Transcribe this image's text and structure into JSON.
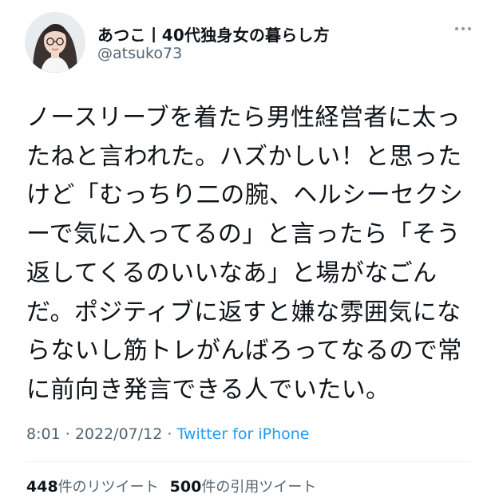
{
  "author": {
    "display_name": "あつこ丨40代独身女の暮らし方",
    "handle": "@atsuko73",
    "avatar_icon": "profile-photo-avatar"
  },
  "tweet": {
    "lines": [
      "ノースリーブを着たら男性経営者に太っ",
      "たねと言われた。ハズかしい！と思った",
      "けど「むっちり二の腕、ヘルシーセクシ",
      "ーで気に入ってるの」と言ったら「そう",
      "返してくるのいいなあ」と場がなごん",
      "だ。ポジティブに返すと嫌な雰囲気にな",
      "らないし筋トレがんばろってなるので常",
      "に前向き発言できる人でいたい。"
    ]
  },
  "meta": {
    "time": "8:01",
    "separator": "·",
    "date": "2022/07/12",
    "source": "Twitter for iPhone"
  },
  "stats": {
    "retweets_count": "448",
    "retweets_label": "件のリツイート",
    "quotes_count": "500",
    "quotes_label": "件の引用ツイート"
  },
  "icons": {
    "more": "more-horizontal-icon"
  },
  "colors": {
    "text": "#0f1419",
    "secondary": "#536471",
    "link": "#1d9bf0",
    "divider": "#eff3f4"
  }
}
